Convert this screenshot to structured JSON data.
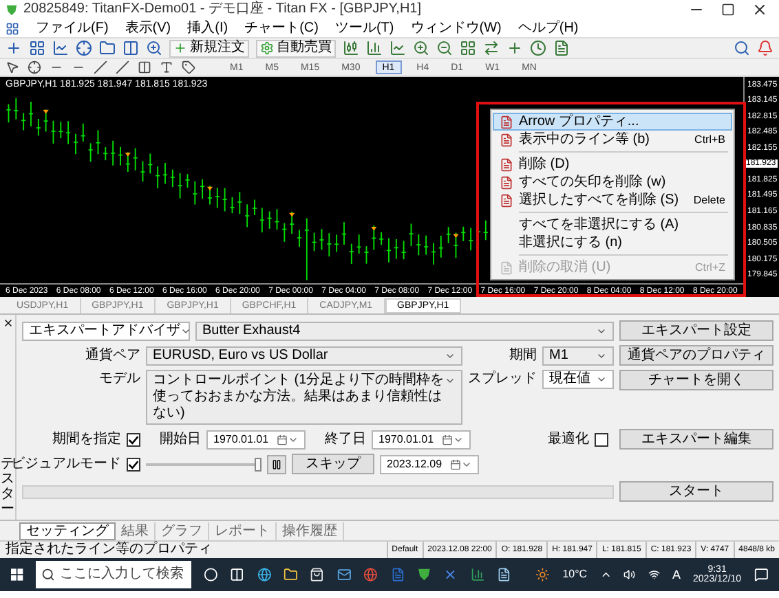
{
  "window": {
    "title": "20825849: TitanFX-Demo01 - デモ口座 - Titan FX - [GBPJPY,H1]"
  },
  "menu": [
    "ファイル(F)",
    "表示(V)",
    "挿入(I)",
    "チャート(C)",
    "ツール(T)",
    "ウィンドウ(W)",
    "ヘルプ(H)"
  ],
  "toolbar": {
    "new_order": "新規注文",
    "auto_trading": "自動売買",
    "timeframes": [
      {
        "label": "M1",
        "selected": false
      },
      {
        "label": "M5",
        "selected": false
      },
      {
        "label": "M15",
        "selected": false
      },
      {
        "label": "M30",
        "selected": false
      },
      {
        "label": "H1",
        "selected": true
      },
      {
        "label": "H4",
        "selected": false
      },
      {
        "label": "D1",
        "selected": false
      },
      {
        "label": "W1",
        "selected": false
      },
      {
        "label": "MN",
        "selected": false
      }
    ]
  },
  "chart": {
    "header": "GBPJPY,H1  181.925 181.947 181.815 181.923",
    "price_labels": [
      "183.475",
      "183.145",
      "182.815",
      "182.485",
      "182.155",
      "181.825",
      "181.495",
      "181.165",
      "180.835",
      "180.505",
      "180.175",
      "179.845"
    ],
    "current_price": "181.923",
    "time_labels": [
      "6 Dec 2023",
      "6 Dec 08:00",
      "6 Dec 12:00",
      "6 Dec 16:00",
      "6 Dec 20:00",
      "7 Dec 00:00",
      "7 Dec 04:00",
      "7 Dec 08:00",
      "7 Dec 12:00",
      "7 Dec 16:00",
      "7 Dec 20:00",
      "8 Dec 04:00",
      "8 Dec 12:00",
      "8 Dec 20:00"
    ]
  },
  "context_menu": {
    "items": [
      {
        "kind": "icon_item",
        "label": "Arrow プロパティ...",
        "selected": true,
        "disabled": false
      },
      {
        "kind": "icon_item",
        "label": "表示中のライン等 (b)",
        "shortcut": "Ctrl+B",
        "selected": false,
        "disabled": false
      },
      {
        "kind": "separator"
      },
      {
        "kind": "icon_item",
        "label": "削除 (D)",
        "selected": false,
        "disabled": false
      },
      {
        "kind": "icon_item",
        "label": "すべての矢印を削除 (w)",
        "selected": false,
        "disabled": false
      },
      {
        "kind": "icon_item",
        "label": "選択したすべてを削除 (S)",
        "shortcut": "Delete",
        "selected": false,
        "disabled": false
      },
      {
        "kind": "separator"
      },
      {
        "kind": "item",
        "label": "すべてを非選択にする (A)",
        "selected": false,
        "disabled": false
      },
      {
        "kind": "item",
        "label": "非選択にする (n)",
        "selected": false,
        "disabled": false
      },
      {
        "kind": "separator"
      },
      {
        "kind": "icon_item",
        "label": "削除の取消 (U)",
        "shortcut": "Ctrl+Z",
        "selected": false,
        "disabled": true
      }
    ]
  },
  "chart_tabs": [
    {
      "label": "USDJPY,H1",
      "selected": false
    },
    {
      "label": "GBPJPY,H1",
      "selected": false
    },
    {
      "label": "GBPJPY,H1",
      "selected": false
    },
    {
      "label": "GBPCHF,H1",
      "selected": false
    },
    {
      "label": "CADJPY,M1",
      "selected": false
    },
    {
      "label": "GBPJPY,H1",
      "selected": true
    }
  ],
  "tester": {
    "side_label": "テスター",
    "expert_selector": "エキスパートアドバイザ",
    "expert": "Butter Exhaust4",
    "expert_settings": "エキスパート設定",
    "symbol_label": "通貨ペア",
    "symbol": "EURUSD, Euro vs US Dollar",
    "period_label": "期間",
    "period": "M1",
    "symbol_properties": "通貨ペアのプロパティ",
    "model_label": "モデル",
    "model": "コントロールポイント (1分足より下の時間枠を使っておおまかな方法。結果はあまり信頼性はない)",
    "spread_label": "スプレッド",
    "spread": "現在値",
    "open_chart": "チャートを開く",
    "use_date": {
      "label": "期間を指定",
      "checked": true
    },
    "from_label": "開始日",
    "from": "1970.01.01",
    "to_label": "終了日",
    "to": "1970.01.01",
    "optimization": {
      "label": "最適化",
      "checked": false
    },
    "edit_expert": "エキスパート編集",
    "visual_mode": {
      "label": "ビジュアルモード",
      "checked": true
    },
    "speed": {
      "level": 1
    },
    "skip": "スキップ",
    "skip_to": "2023.12.09",
    "progress": {
      "level": 0
    },
    "start": "スタート"
  },
  "bottom_tabs": [
    {
      "label": "セッティング",
      "selected": true
    },
    {
      "label": "結果",
      "selected": false
    },
    {
      "label": "グラフ",
      "selected": false
    },
    {
      "label": "レポート",
      "selected": false
    },
    {
      "label": "操作履歴",
      "selected": false
    }
  ],
  "status_bar": {
    "hint": "指定されたライン等のプロパティ",
    "cells": [
      "Default",
      "2023.12.08 22:00",
      "O: 181.928",
      "H: 181.947",
      "L: 181.815",
      "C: 181.923",
      "V: 4747",
      "4848/8 kb"
    ]
  },
  "taskbar": {
    "search_placeholder": "ここに入力して検索",
    "weather": "10°C",
    "ime": "A",
    "time": "9:31",
    "date": "2023/12/10"
  }
}
